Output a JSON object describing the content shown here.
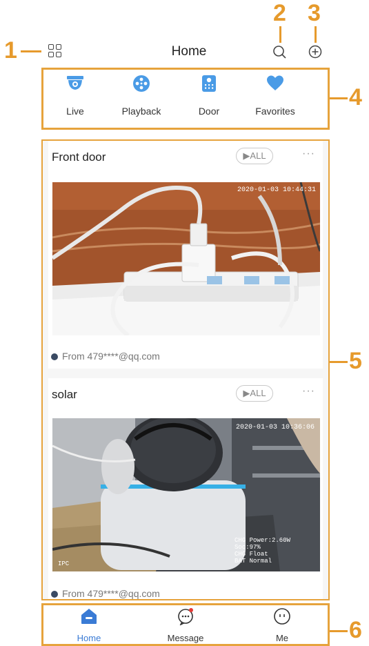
{
  "header": {
    "title": "Home"
  },
  "callouts": [
    "1",
    "2",
    "3",
    "4",
    "5",
    "6"
  ],
  "quick_access": [
    {
      "label": "Live",
      "icon": "live-camera-icon"
    },
    {
      "label": "Playback",
      "icon": "playback-reel-icon"
    },
    {
      "label": "Door",
      "icon": "door-intercom-icon"
    },
    {
      "label": "Favorites",
      "icon": "heart-icon"
    }
  ],
  "devices": [
    {
      "name": "Front door",
      "all_label": "▶ALL",
      "more": "···",
      "from": "From 479****@qq.com",
      "stamp": "2020-01-03 10:44:31"
    },
    {
      "name": "solar",
      "all_label": "▶ALL",
      "more": "···",
      "from": "From 479****@qq.com",
      "stamp": "2020-01-03 10:36:06",
      "overlay": [
        "CHG Power:2.60W",
        "Soc:97%",
        "CHG Float",
        "BAT Normal"
      ],
      "corner": "IPC"
    }
  ],
  "bottom_tabs": [
    {
      "label": "Home",
      "icon": "home-icon",
      "active": true
    },
    {
      "label": "Message",
      "icon": "message-icon",
      "active": false
    },
    {
      "label": "Me",
      "icon": "me-face-icon",
      "active": false
    }
  ],
  "colors": {
    "accent": "#3a7bd5",
    "callout": "#e69a2c",
    "icon_blue": "#4a9be6"
  }
}
